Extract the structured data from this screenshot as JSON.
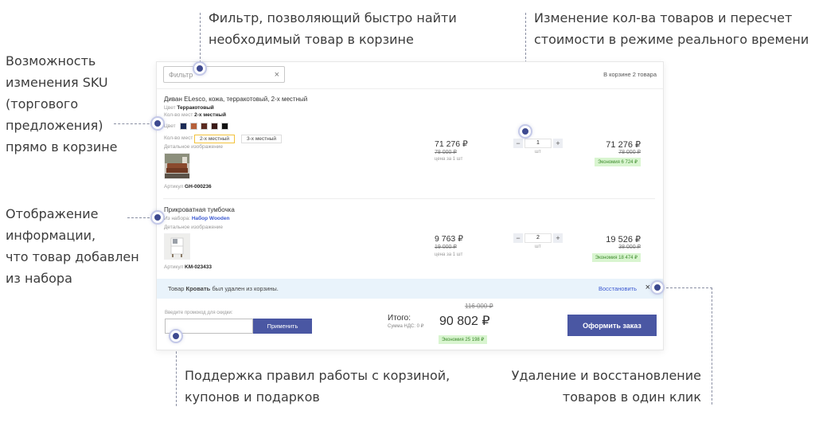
{
  "callouts": {
    "filter": [
      "Фильтр, позволяющий быстро найти",
      "необходимый товар в корзине"
    ],
    "quantity": [
      "Изменение кол-ва товаров и пересчет",
      "стоимости в режиме реального времени"
    ],
    "sku": [
      "Возможность",
      "изменения SKU",
      "(торгового",
      "предложения)",
      "прямо в корзине"
    ],
    "set": [
      "Отображение",
      "информации,",
      "что товар добавлен",
      "из набора"
    ],
    "coupons": [
      "Поддержка правил работы с корзиной,",
      "купонов и подарков"
    ],
    "delete": [
      "Удаление и восстановление",
      "товаров в один клик"
    ]
  },
  "cart": {
    "filter_placeholder": "Фильтр",
    "filter_clear": "×",
    "count_text": "В корзине 2 товара",
    "items": [
      {
        "name": "Диван ELesco, кожа, терракотовый, 2-х местный",
        "color_label": "Цвет",
        "color_value": "Терракотовый",
        "seats_label": "Кол-во мест",
        "seats_value": "2-х местный",
        "swatch_label": "Цвет",
        "swatches": [
          "#1b2a55",
          "#b5603a",
          "#5a2a1f",
          "#3a1a16",
          "#111111"
        ],
        "seats_options": [
          "2-х местный",
          "3-х местный"
        ],
        "image_label": "Детальное изображение",
        "article_label": "Артикул",
        "article": "GH-000236",
        "price": "71 276 ₽",
        "old_price": "78 000 ₽",
        "unit_price_label": "цена за 1 шт",
        "quantity": "1",
        "qty_unit": "шт",
        "sum": "71 276 ₽",
        "old_sum": "78 000 ₽",
        "savings": "Экономия 6 724 ₽"
      },
      {
        "name": "Прикроватная тумбочка",
        "set_label": "Из набора:",
        "set_value": "Набор Wooden",
        "image_label": "Детальное изображение",
        "article_label": "Артикул",
        "article": "KM-023433",
        "price": "9 763 ₽",
        "old_price": "19 000 ₽",
        "unit_price_label": "цена за 1 шт",
        "quantity": "2",
        "qty_unit": "шт",
        "sum": "19 526 ₽",
        "old_sum": "38 000 ₽",
        "savings": "Экономия 18 474 ₽"
      }
    ],
    "minus": "−",
    "plus": "+",
    "removed_prefix": "Товар",
    "removed_item": "Кровать",
    "removed_suffix": "был удален из корзины.",
    "restore_label": "Восстановить",
    "close_label": "×",
    "promo_label": "Введите промокод для скидки:",
    "apply_label": "Применить",
    "total_label": "Итого:",
    "vat_label": "Сумма НДС: 0 ₽",
    "total_old": "116 000 ₽",
    "total": "90 802 ₽",
    "total_savings": "Экономия 25 198 ₽",
    "checkout_label": "Оформить заказ"
  }
}
